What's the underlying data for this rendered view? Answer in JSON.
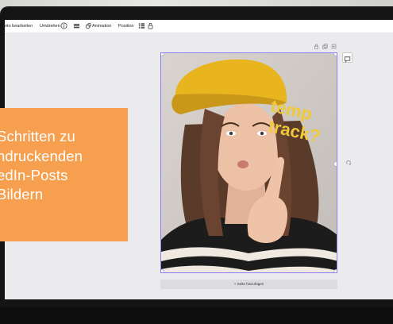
{
  "toolbar": {
    "edit_photo": "oto bearbeiten",
    "flip": "Umdrehen",
    "animation": "Animation",
    "position": "Position"
  },
  "canvas": {
    "photo_text": "temp\ntrack?",
    "photo_text_line1": "temp",
    "photo_text_line2": "track?"
  },
  "add_page_label": "+ Seite hinzufügen",
  "overlay_card": {
    "line1": "Schritten zu",
    "line2": "ndruckenden",
    "line3": "edIn-Posts",
    "line4": "Bildern"
  },
  "colors": {
    "accent_orange": "#f59f4f",
    "hat_yellow": "#e8b51f",
    "sticker_yellow": "#f0c93a",
    "selection_purple": "#8b7cf6"
  },
  "icons": [
    "info-icon",
    "menu-icon",
    "animation-icon",
    "grid-icon",
    "lock-icon",
    "duplicate-icon",
    "copy-icon",
    "add-page-icon",
    "comment-icon",
    "more-icon"
  ]
}
